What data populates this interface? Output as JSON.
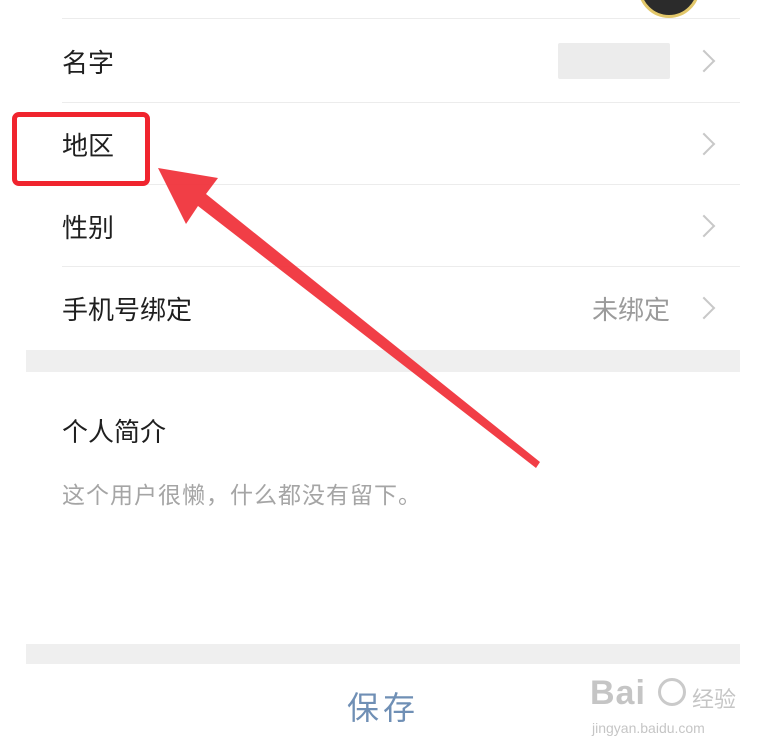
{
  "profile": {
    "rows": [
      {
        "label": "名字",
        "value": ""
      },
      {
        "label": "地区",
        "value": ""
      },
      {
        "label": "性别",
        "value": ""
      },
      {
        "label": "手机号绑定",
        "value": "未绑定"
      }
    ]
  },
  "intro": {
    "title": "个人简介",
    "placeholder": "这个用户很懒，什么都没有留下。"
  },
  "footer": {
    "save_label": "保存"
  },
  "watermark": {
    "brand": "Bai",
    "brand_suffix": "经验",
    "url": "jingyan.baidu.com"
  },
  "colors": {
    "highlight": "#f0242e",
    "save_text": "#6f8fb5",
    "section_gap": "#efefef"
  }
}
